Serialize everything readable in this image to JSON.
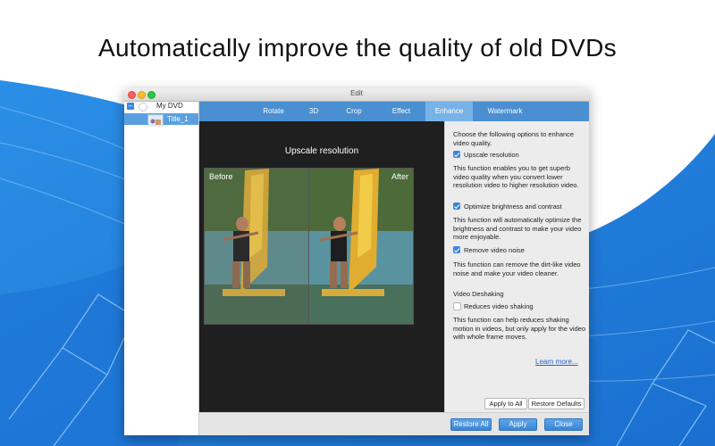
{
  "headline": "Automatically improve the quality of old DVDs",
  "colors": {
    "accent": "#4a8fd0",
    "brand_bg": "#1e88e5"
  },
  "window": {
    "title": "Edit"
  },
  "tree": {
    "root_label": "My DVD",
    "child_label": "Title_1"
  },
  "tabs": [
    "Rotate",
    "3D",
    "Crop",
    "Effect",
    "Enhance",
    "Watermark"
  ],
  "active_tab": "Enhance",
  "preview": {
    "title": "Upscale resolution",
    "before_label": "Before",
    "after_label": "After"
  },
  "options": {
    "intro": "Choose the following options to enhance video quality.",
    "upscale": {
      "label": "Upscale resolution",
      "checked": true,
      "desc": "This function enables you to get superb video quality when you convert lower resolution video to higher resolution video."
    },
    "brightness": {
      "label": "Optimize brightness and contrast",
      "checked": true,
      "desc": "This function will automatically optimize the brightness and contrast to make your video more enjoyable."
    },
    "noise": {
      "label": "Remove video noise",
      "checked": true,
      "desc": "This function can remove the dirt-like video noise and make your video cleaner."
    },
    "deshake_heading": "Video Deshaking",
    "deshake": {
      "label": "Reduces video shaking",
      "checked": false,
      "desc": "This function can help reduces shaking motion in videos, but only apply for the video with whole frame moves."
    },
    "learn_more": "Learn more...",
    "apply_all": "Apply to All",
    "restore_defaults": "Restore Defaults"
  },
  "bottom": {
    "restore_all": "Restore All",
    "apply": "Apply",
    "close": "Close"
  }
}
